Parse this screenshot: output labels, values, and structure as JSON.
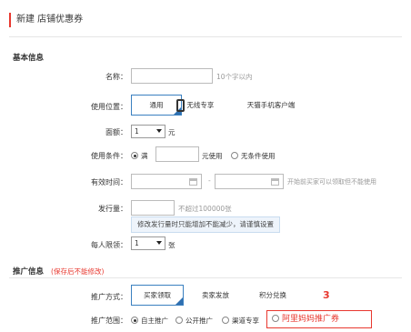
{
  "page_title": "新建 店铺优惠券",
  "basic_section": "基本信息",
  "fields": {
    "name_label": "名称：",
    "name_hint": "10个字以内",
    "location_label": "使用位置：",
    "location_options": [
      "通用",
      "无线专享",
      "天猫手机客户端"
    ],
    "face_label": "面额：",
    "face_value": "1",
    "face_unit": "元",
    "condition_label": "使用条件：",
    "condition_full": "满",
    "condition_use": "元使用",
    "condition_none": "无条件使用",
    "period_label": "有效时间：",
    "period_sep": "-",
    "period_hint": "开始前买家可以领取但不能使用",
    "amount_label": "发行量：",
    "amount_hint": "不超过100000张",
    "amount_tip": "修改发行量时只能增加不能减少，请谨慎设置",
    "limit_label": "每人限领：",
    "limit_value": "1",
    "limit_unit": "张"
  },
  "promo_section": "推广信息",
  "promo_note": "(保存后不能修改)",
  "promo": {
    "method_label": "推广方式：",
    "method_options": [
      "买家领取",
      "卖家发放",
      "积分兑换"
    ],
    "annotation_number": "3",
    "scope_label": "推广范围：",
    "scope_options": [
      "自主推广",
      "公开推广",
      "渠道专享",
      "阿里妈妈推广券"
    ]
  },
  "colors": {
    "accent": "#e8382f",
    "active_border": "#3a80c0"
  }
}
